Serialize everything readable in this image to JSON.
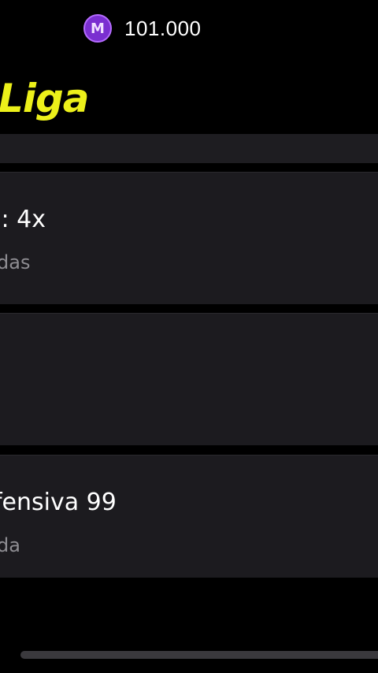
{
  "header": {
    "coin_icon_letter": "M",
    "coin_balance": "101.000",
    "title": "Liga"
  },
  "cards": [
    {
      "title": ".: 4x",
      "subtitle": "das"
    },
    {
      "title": "",
      "subtitle": ""
    },
    {
      "title": "fensiva 99",
      "subtitle": "da"
    }
  ],
  "colors": {
    "title_yellow": "#ecf01a",
    "coin_purple": "#7a2fd0",
    "card_bg": "#1c1b1f",
    "subtitle_gray": "#8e8d92"
  },
  "icons": {
    "coin": "coin-icon"
  }
}
